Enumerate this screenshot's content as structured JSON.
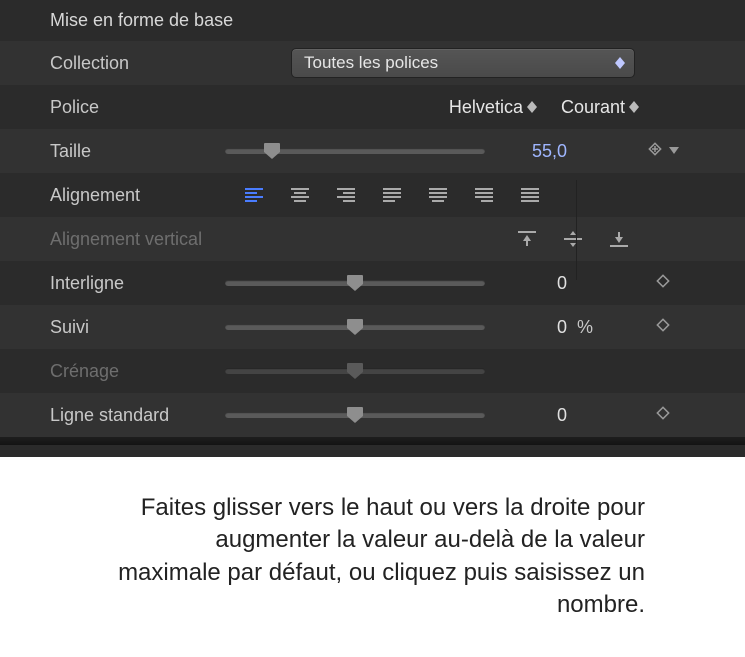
{
  "panel": {
    "title": "Mise en forme de base",
    "collection": {
      "label": "Collection",
      "selected": "Toutes les polices"
    },
    "font": {
      "label": "Police",
      "family": "Helvetica",
      "style": "Courant"
    },
    "size": {
      "label": "Taille",
      "value": "55,0",
      "slider_pos_pct": 18
    },
    "alignment": {
      "label": "Alignement",
      "active_index": 0,
      "buttons": [
        "align-left",
        "align-center",
        "align-right",
        "align-justify-left",
        "align-justify",
        "align-justify-right",
        "align-justify-full"
      ]
    },
    "valign": {
      "label": "Alignement vertical",
      "buttons": [
        "valign-top",
        "valign-middle",
        "valign-bottom"
      ]
    },
    "leading": {
      "label": "Interligne",
      "value": "0",
      "slider_pos_pct": 50
    },
    "tracking": {
      "label": "Suivi",
      "value": "0",
      "unit": "%",
      "slider_pos_pct": 50
    },
    "kerning": {
      "label": "Crénage",
      "slider_pos_pct": 50
    },
    "baseline": {
      "label": "Ligne standard",
      "value": "0",
      "slider_pos_pct": 50
    }
  },
  "callout": {
    "text": "Faites glisser vers le haut ou vers la droite pour augmenter la valeur au-delà de la valeur maximale par défaut, ou cliquez puis saisissez un nombre."
  }
}
